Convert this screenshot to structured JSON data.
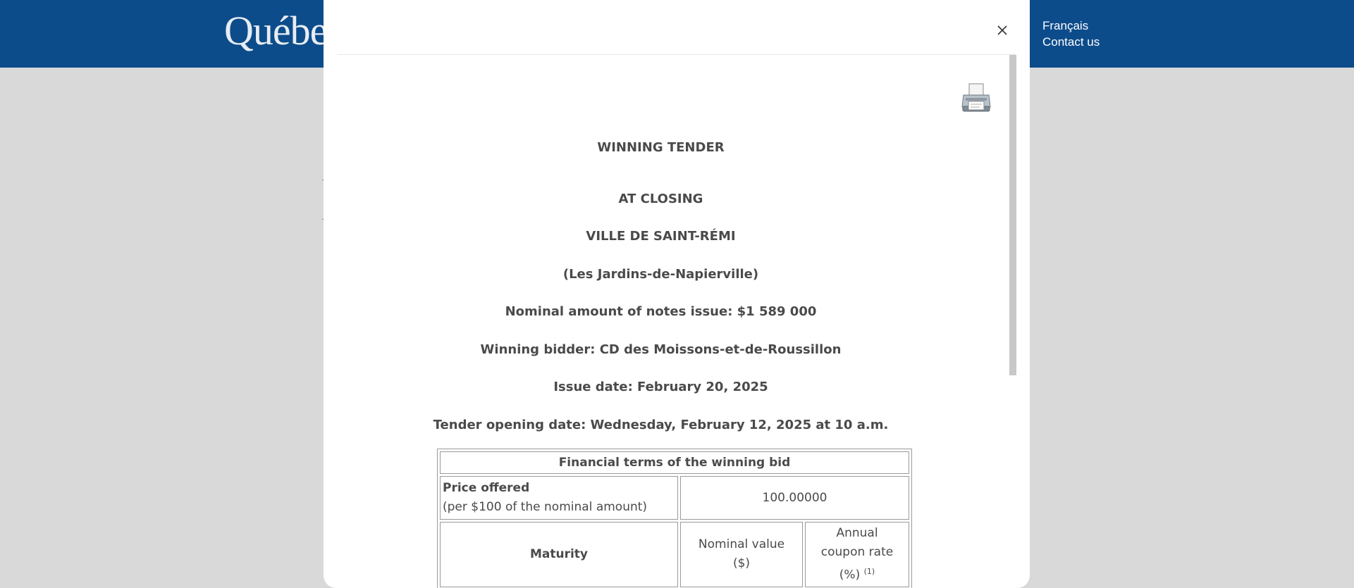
{
  "header": {
    "brand": "Québec",
    "links": [
      "Français",
      "Contact us"
    ]
  },
  "modal": {
    "close_label": "×",
    "title": "WINNING TENDER",
    "status": "AT CLOSING",
    "issuer": "VILLE DE SAINT-RÉMI",
    "region": "(Les Jardins-de-Napierville)",
    "nominal_amount": "Nominal amount of notes issue: $1 589 000",
    "winning_bidder": "Winning bidder: CD des Moissons-et-de-Roussillon",
    "issue_date": "Issue date: February 20, 2025",
    "opening_date": "Tender opening date:  Wednesday, February 12, 2025 at 10 a.m."
  },
  "table": {
    "heading": "Financial terms of the winning bid",
    "price_label": "Price offered",
    "price_sub": "(per $100 of the nominal amount)",
    "price_value": "100.00000",
    "col_maturity": "Maturity",
    "col_nominal_1": "Nominal value",
    "col_nominal_2": "($)",
    "col_coupon_1": "Annual",
    "col_coupon_2": "coupon rate",
    "col_coupon_3": "(%)",
    "col_coupon_note": "(1)"
  },
  "colors": {
    "header_bg": "#0d4c8b",
    "backdrop": "#d9d9d9",
    "text": "#4a4a4a"
  },
  "icons": [
    "close-icon",
    "printer-icon"
  ]
}
